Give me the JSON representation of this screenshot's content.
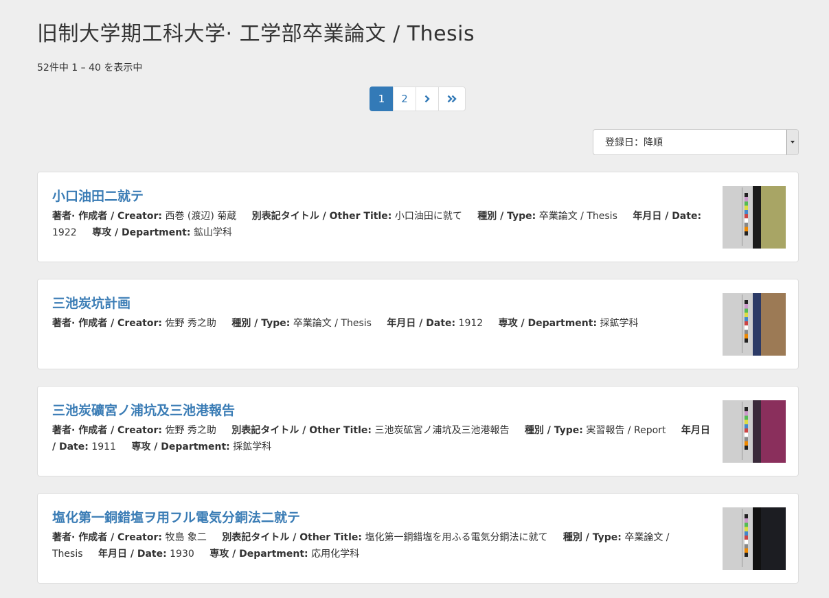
{
  "page": {
    "title": "旧制大学期工科大学· 工学部卒業論文 / Thesis",
    "result_count": "52件中 1 – 40 を表示中"
  },
  "pagination": {
    "pages": [
      "1",
      "2"
    ],
    "current": "1",
    "next_icon": "chevron-right-icon",
    "last_icon": "double-chevron-right-icon"
  },
  "sort": {
    "selected": "登録日：降順"
  },
  "labels": {
    "creator": "著者· 作成者 / Creator:",
    "other_title": "別表記タイトル / Other Title:",
    "type": "種別 / Type:",
    "date": "年月日 / Date:",
    "department": "専攻 / Department:"
  },
  "items": [
    {
      "title": "小口油田二就テ",
      "creator": "西巻 (渡辺) 菊蔵",
      "other_title": "小口油田に就て",
      "type": "卒業論文 / Thesis",
      "date": "1922",
      "department": "鉱山学科",
      "thumb_colors": [
        "#a8a565",
        "#1b1b1b"
      ]
    },
    {
      "title": "三池炭坑計画",
      "creator": "佐野 秀之助",
      "type": "卒業論文 / Thesis",
      "date": "1912",
      "department": "採鉱学科",
      "thumb_colors": [
        "#9c7a55",
        "#2c3a66"
      ]
    },
    {
      "title": "三池炭礦宮ノ浦坑及三池港報告",
      "creator": "佐野 秀之助",
      "other_title": "三池炭砿宮ノ浦坑及三池港報告",
      "type": "実習報告 / Report",
      "date": "1911",
      "department": "採鉱学科",
      "thumb_colors": [
        "#8a2f5c",
        "#3a2a3a"
      ]
    },
    {
      "title": "塩化第一銅錯塩ヲ用フル電気分銅法二就テ",
      "creator": "牧島 象二",
      "other_title": "塩化第一銅錯塩を用ふる電気分銅法に就て",
      "type": "卒業論文 / Thesis",
      "date": "1930",
      "department": "応用化学科",
      "thumb_colors": [
        "#1c1d22",
        "#111111"
      ]
    }
  ]
}
